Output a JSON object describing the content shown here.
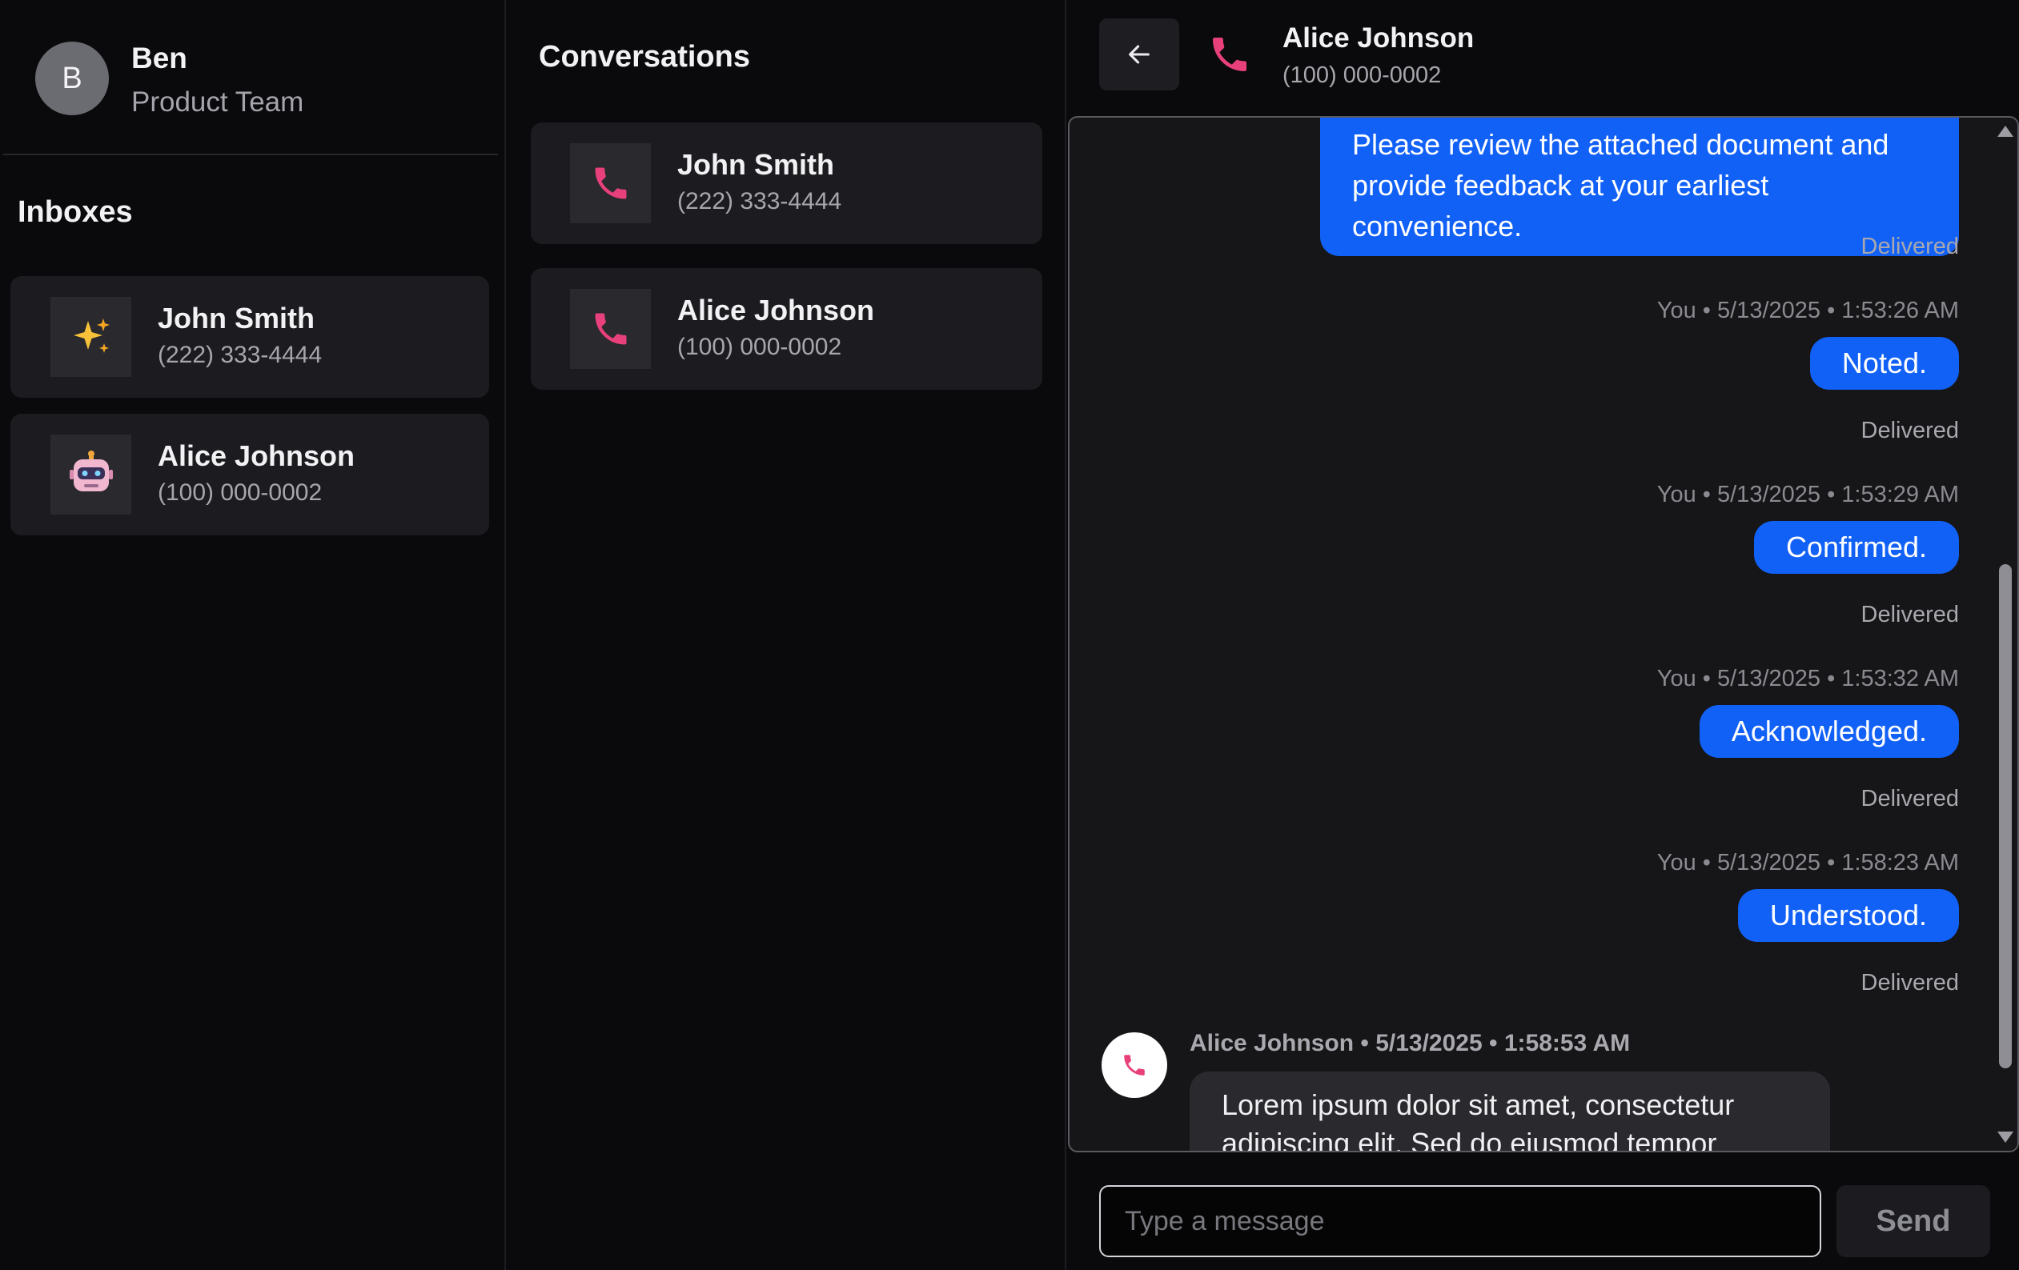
{
  "user": {
    "initial": "B",
    "name": "Ben",
    "team": "Product Team"
  },
  "inboxes": {
    "title": "Inboxes",
    "items": [
      {
        "name": "John Smith",
        "phone": "(222) 333-4444",
        "icon": "sparkles-icon"
      },
      {
        "name": "Alice Johnson",
        "phone": "(100) 000-0002",
        "icon": "robot-icon"
      }
    ]
  },
  "conversations": {
    "title": "Conversations",
    "items": [
      {
        "name": "John Smith",
        "phone": "(222) 333-4444",
        "icon": "phone-icon"
      },
      {
        "name": "Alice Johnson",
        "phone": "(100) 000-0002",
        "icon": "phone-icon"
      }
    ]
  },
  "chat": {
    "contact_name": "Alice Johnson",
    "contact_phone": "(100) 000-0002",
    "messages": [
      {
        "direction": "out",
        "text": "Please review the attached document and provide feedback at your earliest convenience.",
        "status": "Delivered"
      },
      {
        "direction": "out",
        "meta": "You • 5/13/2025 • 1:53:26 AM",
        "text": "Noted.",
        "status": "Delivered"
      },
      {
        "direction": "out",
        "meta": "You • 5/13/2025 • 1:53:29 AM",
        "text": "Confirmed.",
        "status": "Delivered"
      },
      {
        "direction": "out",
        "meta": "You • 5/13/2025 • 1:53:32 AM",
        "text": "Acknowledged.",
        "status": "Delivered"
      },
      {
        "direction": "out",
        "meta": "You • 5/13/2025 • 1:58:23 AM",
        "text": "Understood.",
        "status": "Delivered"
      },
      {
        "direction": "in",
        "meta": "Alice Johnson • 5/13/2025 • 1:58:53 AM",
        "text": "Lorem ipsum dolor sit amet, consectetur adipiscing elit. Sed do eiusmod tempor"
      }
    ],
    "composer": {
      "placeholder": "Type a message",
      "value": ""
    },
    "send_label": "Send"
  },
  "colors": {
    "accent_blue": "#1261f6",
    "phone_icon_pink": "#e8407a",
    "background": "#0a0a0c",
    "card": "#1c1c20"
  }
}
